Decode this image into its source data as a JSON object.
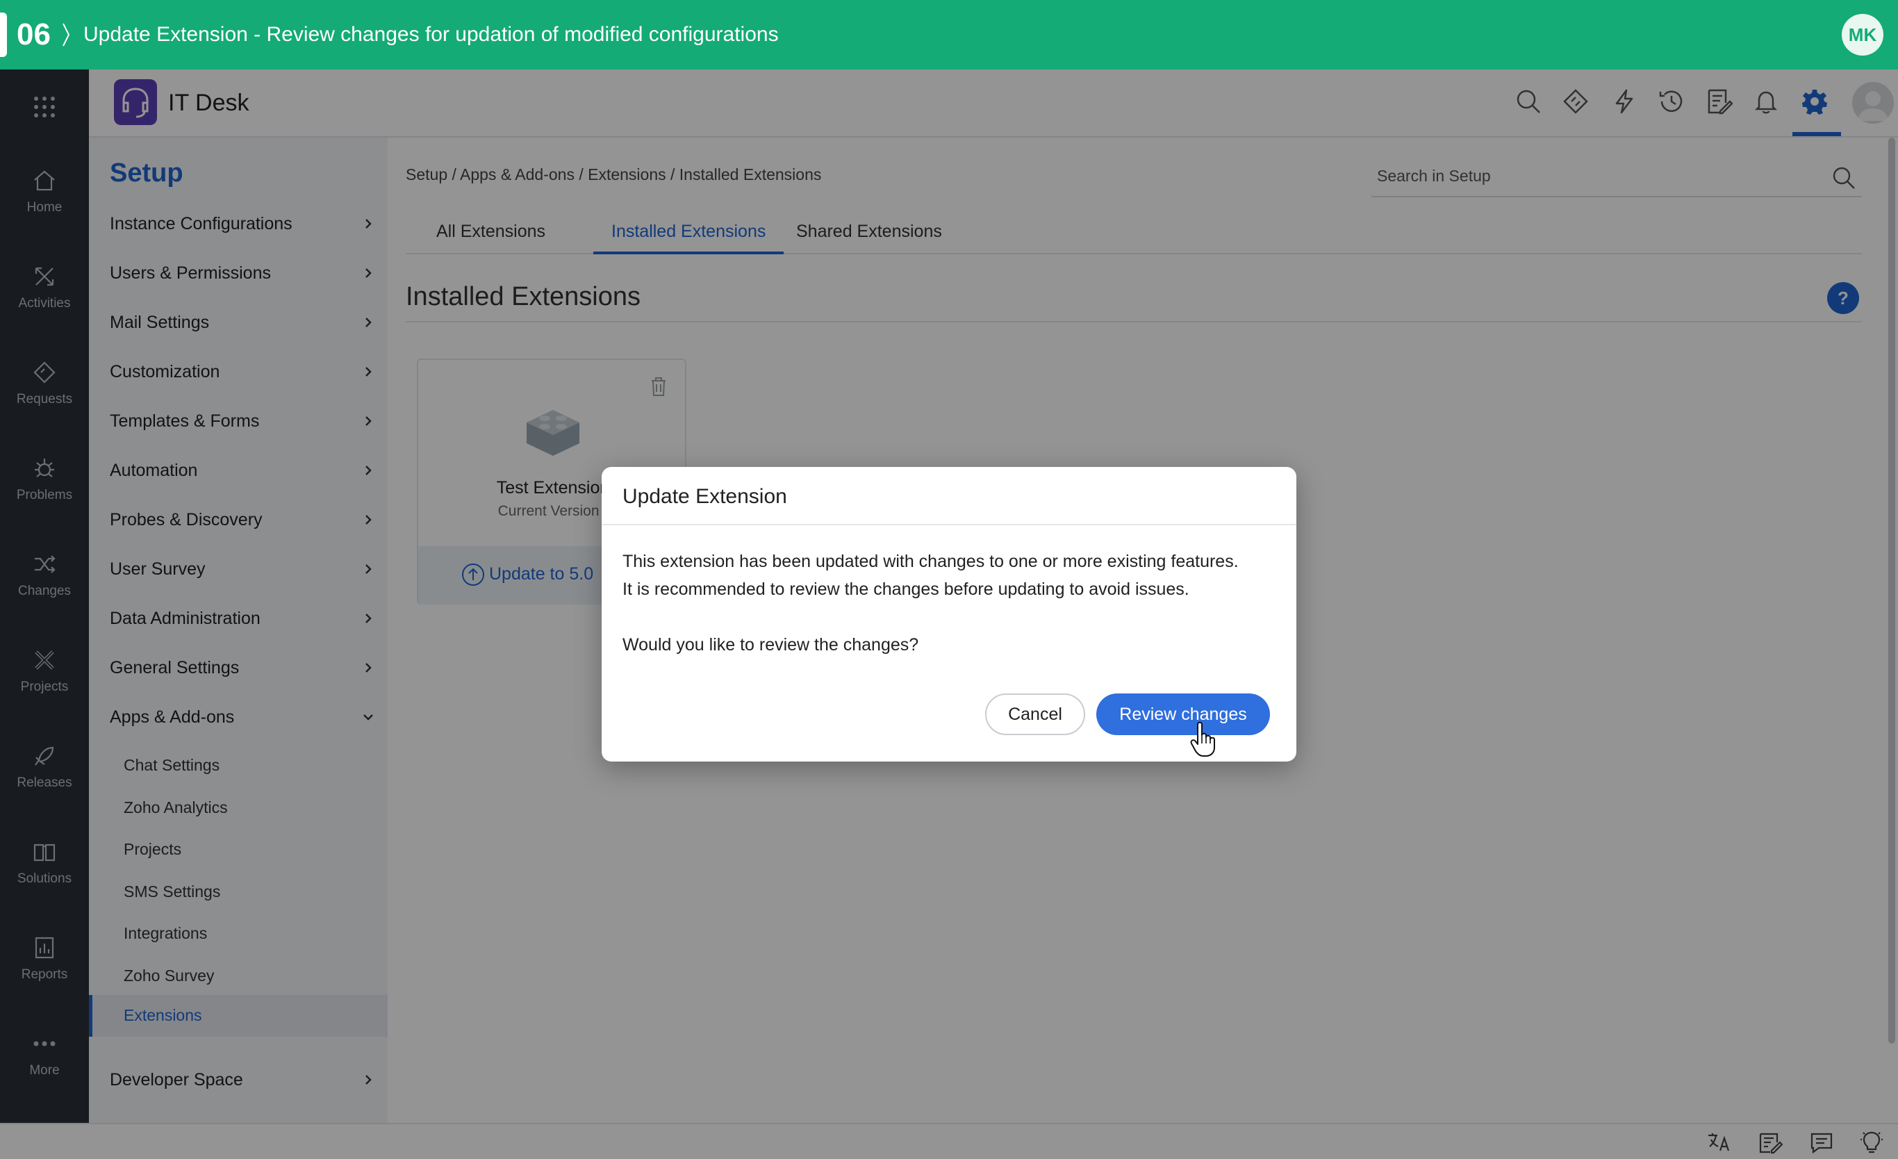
{
  "banner": {
    "step": "06",
    "title": "Update Extension - Review changes for updation of modified configurations",
    "avatar_initials": "MK",
    "color": "#14ab76"
  },
  "rail": {
    "items": [
      {
        "label": "Home",
        "icon": "home-icon"
      },
      {
        "label": "Activities",
        "icon": "activities-icon"
      },
      {
        "label": "Requests",
        "icon": "ticket-icon"
      },
      {
        "label": "Problems",
        "icon": "bug-icon"
      },
      {
        "label": "Changes",
        "icon": "shuffle-icon"
      },
      {
        "label": "Projects",
        "icon": "projects-icon"
      },
      {
        "label": "Releases",
        "icon": "rocket-icon"
      },
      {
        "label": "Solutions",
        "icon": "book-icon"
      },
      {
        "label": "Reports",
        "icon": "chart-icon"
      },
      {
        "label": "More",
        "icon": "more-icon"
      }
    ]
  },
  "header": {
    "app_name": "IT Desk",
    "icons": [
      "search-icon",
      "wand-icon",
      "lightning-icon",
      "history-icon",
      "checklist-icon",
      "bell-icon",
      "gear-icon"
    ],
    "accent": "#1f64d0"
  },
  "setup": {
    "heading": "Setup",
    "items": [
      {
        "label": "Instance Configurations"
      },
      {
        "label": "Users & Permissions"
      },
      {
        "label": "Mail Settings"
      },
      {
        "label": "Customization"
      },
      {
        "label": "Templates & Forms"
      },
      {
        "label": "Automation"
      },
      {
        "label": "Probes & Discovery"
      },
      {
        "label": "User Survey"
      },
      {
        "label": "Data Administration"
      },
      {
        "label": "General Settings"
      },
      {
        "label": "Apps & Add-ons"
      }
    ],
    "subitems": [
      {
        "label": "Chat Settings"
      },
      {
        "label": "Zoho Analytics"
      },
      {
        "label": "Projects"
      },
      {
        "label": "SMS Settings"
      },
      {
        "label": "Integrations"
      },
      {
        "label": "Zoho Survey"
      },
      {
        "label": "Extensions"
      }
    ],
    "developer_space": "Developer Space"
  },
  "main": {
    "breadcrumb": "Setup / Apps & Add-ons / Extensions / Installed Extensions",
    "search_placeholder": "Search in Setup",
    "tabs": [
      {
        "label": "All Extensions"
      },
      {
        "label": "Installed Extensions"
      },
      {
        "label": "Shared Extensions"
      }
    ],
    "title": "Installed Extensions",
    "help": "?"
  },
  "card": {
    "name": "Test Extension",
    "version": "Current Version -",
    "update_label": "Update to 5.0"
  },
  "modal": {
    "title": "Update Extension",
    "line1": "This extension has been updated with changes to one or more existing features.",
    "line2": "It is recommended to review the changes before updating to avoid issues.",
    "question": "Would you like to review the changes?",
    "cancel_label": "Cancel",
    "primary_label": "Review changes",
    "primary_color": "#2f6fde"
  },
  "statusbar": {
    "icons": [
      "translate-icon",
      "notes-icon",
      "chat-icon",
      "bulb-icon"
    ]
  }
}
